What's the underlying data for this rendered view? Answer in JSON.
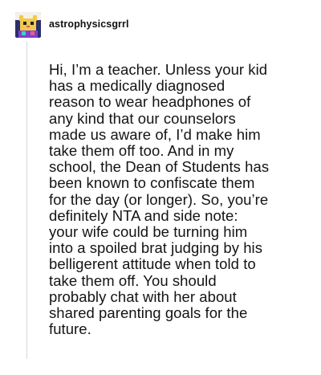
{
  "post": {
    "username": "astrophysicsgrrl",
    "avatar_icon": "pixel-cat-avatar-icon",
    "body_lines": [
      "Hi, I’m a teacher. Unless your kid",
      "has a medically diagnosed",
      "reason to wear headphones of",
      "any kind that our counselors",
      "made us aware of, I’d make him",
      "take them off too. And in my",
      "school, the Dean of Students has",
      "been known to confiscate them",
      "for the day (or longer). So, you’re",
      "definitely NTA and side note:",
      "your wife could be turning him",
      "into a spoiled brat judging by his",
      "belligerent attitude when told to",
      "take them off. You should",
      "probably chat with her about",
      "shared parenting goals for the",
      "future."
    ]
  },
  "colors": {
    "avatar_bg": "#2b2f6b",
    "avatar_accent": "#f2c94c",
    "thread_line": "#d8d8d8"
  }
}
